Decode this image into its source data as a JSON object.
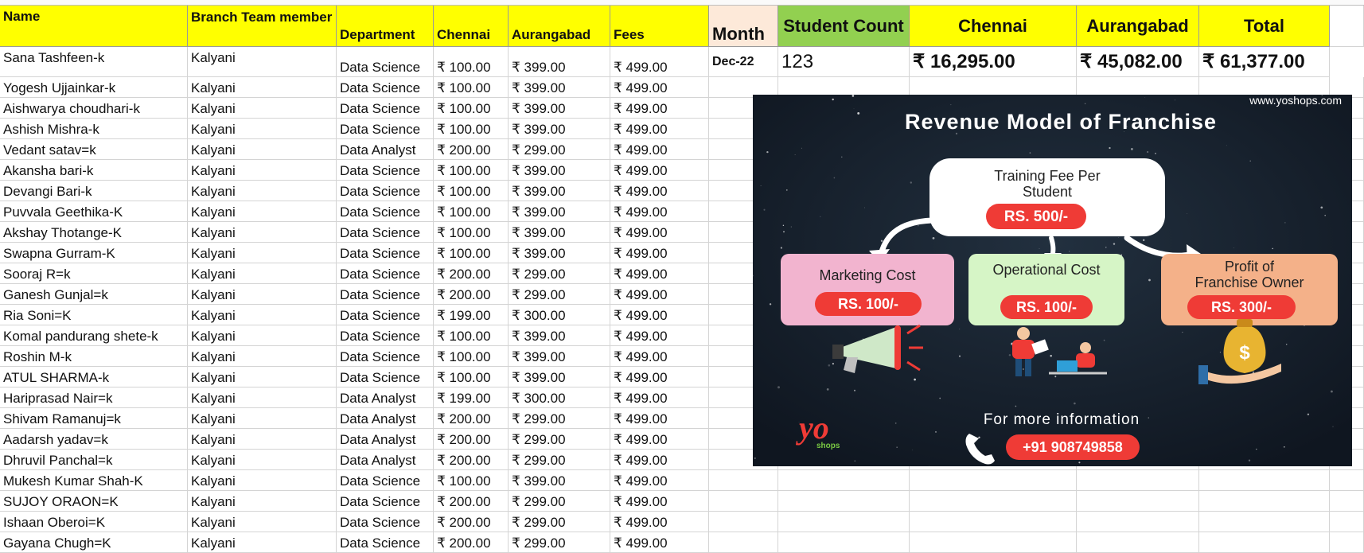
{
  "headers": {
    "name": "Name",
    "branch": "Branch Team member",
    "department": "Department",
    "chennai": "Chennai",
    "aurangabad": "Aurangabad",
    "fees": "Fees"
  },
  "rows": [
    {
      "name": "Sana Tashfeen-k",
      "branch": "Kalyani",
      "department": "Data Science",
      "chennai": "₹ 100.00",
      "aurangabad": "₹ 399.00",
      "fees": "₹ 499.00"
    },
    {
      "name": "Yogesh Ujjainkar-k",
      "branch": "Kalyani",
      "department": "Data Science",
      "chennai": "₹ 100.00",
      "aurangabad": "₹ 399.00",
      "fees": "₹ 499.00"
    },
    {
      "name": "Aishwarya choudhari-k",
      "branch": "Kalyani",
      "department": "Data Science",
      "chennai": "₹ 100.00",
      "aurangabad": "₹ 399.00",
      "fees": "₹ 499.00"
    },
    {
      "name": "Ashish Mishra-k",
      "branch": "Kalyani",
      "department": "Data Science",
      "chennai": "₹ 100.00",
      "aurangabad": "₹ 399.00",
      "fees": "₹ 499.00"
    },
    {
      "name": "Vedant satav=k",
      "branch": "Kalyani",
      "department": "Data Analyst",
      "chennai": "₹ 200.00",
      "aurangabad": "₹ 299.00",
      "fees": "₹ 499.00"
    },
    {
      "name": "Akansha bari-k",
      "branch": "Kalyani",
      "department": "Data Science",
      "chennai": "₹ 100.00",
      "aurangabad": "₹ 399.00",
      "fees": "₹ 499.00"
    },
    {
      "name": "Devangi Bari-k",
      "branch": "Kalyani",
      "department": "Data Science",
      "chennai": "₹ 100.00",
      "aurangabad": "₹ 399.00",
      "fees": "₹ 499.00"
    },
    {
      "name": "Puvvala Geethika-K",
      "branch": "Kalyani",
      "department": "Data Science",
      "chennai": "₹ 100.00",
      "aurangabad": "₹ 399.00",
      "fees": "₹ 499.00"
    },
    {
      "name": "Akshay Thotange-K",
      "branch": "Kalyani",
      "department": "Data Science",
      "chennai": "₹ 100.00",
      "aurangabad": "₹ 399.00",
      "fees": "₹ 499.00"
    },
    {
      "name": "Swapna Gurram-K",
      "branch": "Kalyani",
      "department": "Data Science",
      "chennai": "₹ 100.00",
      "aurangabad": "₹ 399.00",
      "fees": "₹ 499.00"
    },
    {
      "name": "Sooraj R=k",
      "branch": "Kalyani",
      "department": "Data Science",
      "chennai": "₹ 200.00",
      "aurangabad": "₹ 299.00",
      "fees": "₹ 499.00"
    },
    {
      "name": "Ganesh Gunjal=k",
      "branch": "Kalyani",
      "department": "Data Science",
      "chennai": "₹ 200.00",
      "aurangabad": "₹ 299.00",
      "fees": "₹ 499.00"
    },
    {
      "name": "Ria Soni=K",
      "branch": "Kalyani",
      "department": "Data Science",
      "chennai": "₹ 199.00",
      "aurangabad": "₹ 300.00",
      "fees": "₹ 499.00"
    },
    {
      "name": "Komal pandurang shete-k",
      "branch": "Kalyani",
      "department": "Data Science",
      "chennai": "₹ 100.00",
      "aurangabad": "₹ 399.00",
      "fees": "₹ 499.00"
    },
    {
      "name": "Roshin M-k",
      "branch": "Kalyani",
      "department": "Data Science",
      "chennai": "₹ 100.00",
      "aurangabad": "₹ 399.00",
      "fees": "₹ 499.00"
    },
    {
      "name": "ATUL SHARMA-k",
      "branch": "Kalyani",
      "department": "Data Science",
      "chennai": "₹ 100.00",
      "aurangabad": "₹ 399.00",
      "fees": "₹ 499.00"
    },
    {
      "name": "Hariprasad Nair=k",
      "branch": "Kalyani",
      "department": "Data Analyst",
      "chennai": "₹ 199.00",
      "aurangabad": "₹ 300.00",
      "fees": "₹ 499.00"
    },
    {
      "name": "Shivam Ramanuj=k",
      "branch": "Kalyani",
      "department": "Data Analyst",
      "chennai": "₹ 200.00",
      "aurangabad": "₹ 299.00",
      "fees": "₹ 499.00"
    },
    {
      "name": "Aadarsh yadav=k",
      "branch": "Kalyani",
      "department": "Data Analyst",
      "chennai": "₹ 200.00",
      "aurangabad": "₹ 299.00",
      "fees": "₹ 499.00"
    },
    {
      "name": "Dhruvil Panchal=k",
      "branch": "Kalyani",
      "department": "Data Analyst",
      "chennai": "₹ 200.00",
      "aurangabad": "₹ 299.00",
      "fees": "₹ 499.00"
    },
    {
      "name": "Mukesh Kumar Shah-K",
      "branch": "Kalyani",
      "department": "Data Science",
      "chennai": "₹ 100.00",
      "aurangabad": "₹ 399.00",
      "fees": "₹ 499.00"
    },
    {
      "name": "SUJOY ORAON=K",
      "branch": "Kalyani",
      "department": "Data Science",
      "chennai": "₹ 200.00",
      "aurangabad": "₹ 299.00",
      "fees": "₹ 499.00"
    },
    {
      "name": "Ishaan Oberoi=K",
      "branch": "Kalyani",
      "department": "Data Science",
      "chennai": "₹ 200.00",
      "aurangabad": "₹ 299.00",
      "fees": "₹ 499.00"
    },
    {
      "name": "Gayana Chugh=K",
      "branch": "Kalyani",
      "department": "Data Science",
      "chennai": "₹ 200.00",
      "aurangabad": "₹ 299.00",
      "fees": "₹ 499.00"
    }
  ],
  "summary": {
    "month_label": "Month",
    "student_count_label": "Student Count",
    "chennai_label": "Chennai",
    "aurangabad_label": "Aurangabad",
    "total_label": "Total",
    "month": "Dec-22",
    "student_count": "123",
    "chennai_total": "₹ 16,295.00",
    "aurangabad_total": "₹ 45,082.00",
    "total": "₹ 61,377.00"
  },
  "poster": {
    "website": "www.yoshops.com",
    "title": "Revenue Model of  Franchise",
    "training_fee_line1": "Training Fee Per",
    "training_fee_line2": "Student",
    "training_fee_amount": "RS. 500/-",
    "marketing_label": "Marketing Cost",
    "marketing_amount": "RS. 100/-",
    "operational_label": "Operational Cost",
    "operational_amount": "RS. 100/-",
    "profit_line1": "Profit of",
    "profit_line2": "Franchise Owner",
    "profit_amount": "RS. 300/-",
    "more_info": "For more information",
    "phone": "+91 908749858",
    "logo_text": "yo",
    "logo_sub": "shops",
    "icons": [
      "megaphone-icon",
      "team-icon",
      "money-bag-icon",
      "phone-icon"
    ]
  },
  "colors": {
    "header_yellow": "#ffff00",
    "month_header": "#fde9d9",
    "student_count_header": "#92d050",
    "poster_bg": "#16202c",
    "pill_red": "#ef3b36",
    "marketing_box": "#f2b4cf",
    "operational_box": "#d6f5c6",
    "profit_box": "#f4b189"
  }
}
